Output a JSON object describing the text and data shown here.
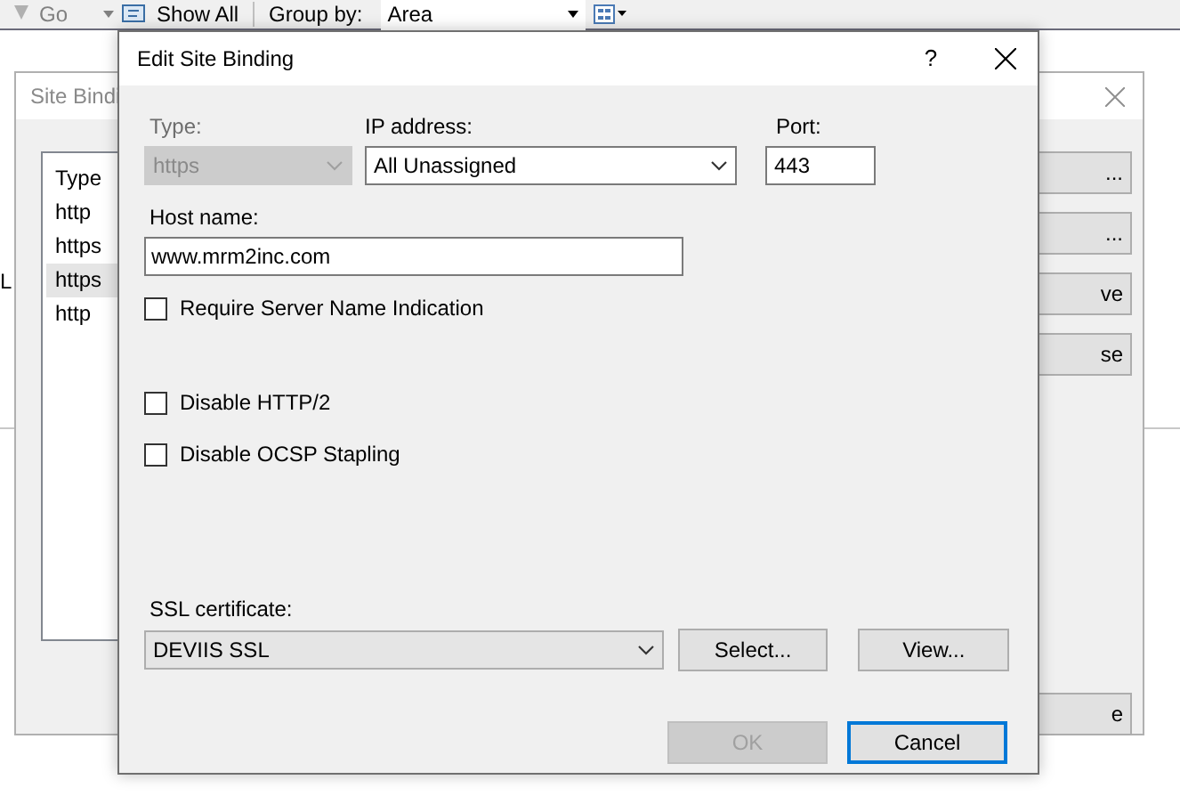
{
  "toolbar": {
    "go": "Go",
    "show_all": "Show All",
    "group_by_label": "Group by:",
    "group_by_value": "Area"
  },
  "site_bindings": {
    "title": "Site Bindi",
    "side_labels": [
      "L"
    ],
    "column": "Type",
    "rows": [
      {
        "type": "http",
        "selected": false
      },
      {
        "type": "https",
        "selected": false
      },
      {
        "type": "https",
        "selected": true
      },
      {
        "type": "http",
        "selected": false
      }
    ],
    "buttons": [
      "...",
      "...",
      "ve",
      "se",
      "e"
    ]
  },
  "dialog": {
    "title": "Edit Site Binding",
    "help": "?",
    "type": {
      "label": "Type:",
      "value": "https",
      "disabled": true
    },
    "ip": {
      "label": "IP address:",
      "value": "All Unassigned"
    },
    "port": {
      "label": "Port:",
      "value": "443"
    },
    "host": {
      "label": "Host name:",
      "value": "www.mrm2inc.com"
    },
    "sni": {
      "label": "Require Server Name Indication",
      "checked": false
    },
    "options": [
      {
        "label": "Disable HTTP/2",
        "checked": false
      },
      {
        "label": "Disable OCSP Stapling",
        "checked": false
      }
    ],
    "ssl": {
      "label": "SSL certificate:",
      "value": "DEVIIS SSL"
    },
    "ssl_buttons": [
      "Select...",
      "View..."
    ],
    "buttons": [
      {
        "label": "OK",
        "disabled": true,
        "default": false
      },
      {
        "label": "Cancel",
        "disabled": false,
        "default": true
      }
    ]
  }
}
